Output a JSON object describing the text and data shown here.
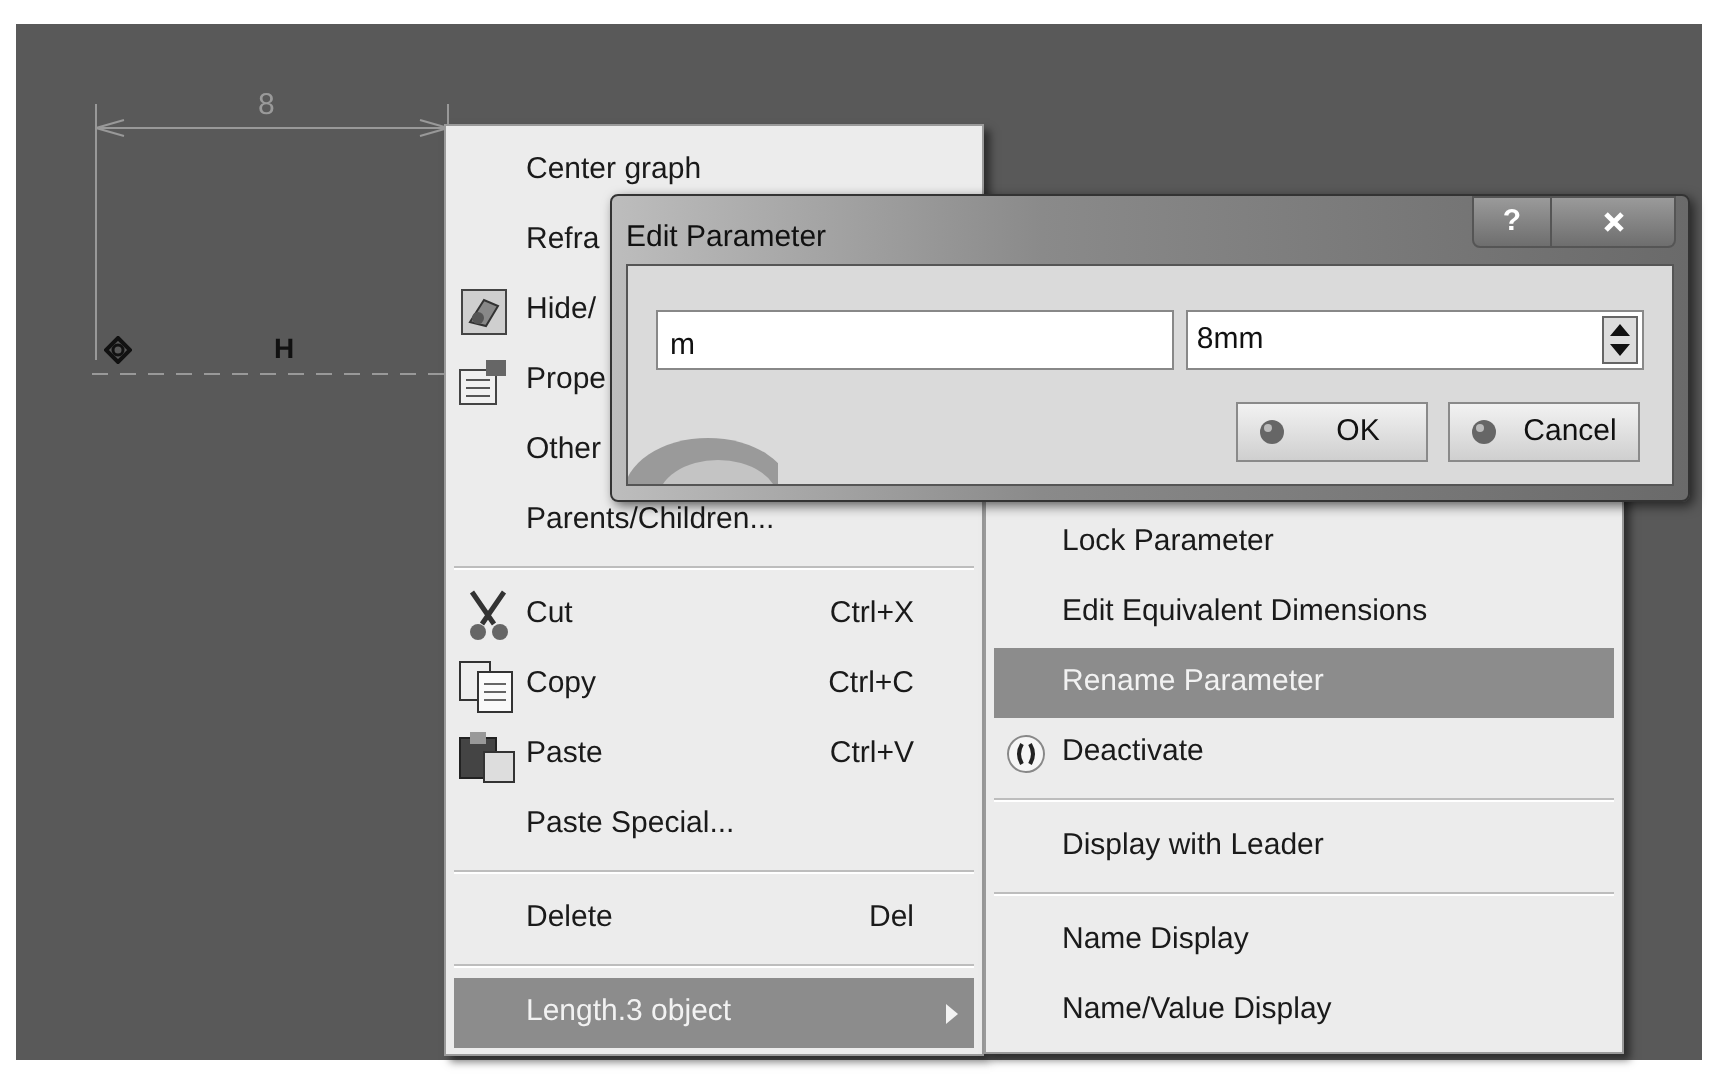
{
  "canvas": {
    "dimension_value": "8",
    "constraint_symbol": "H"
  },
  "context_menu": {
    "groups": [
      [
        {
          "label": "Center graph",
          "kind": "plain",
          "highlighted": false,
          "submenu": false
        },
        {
          "label": "Refra",
          "kind": "plain",
          "highlighted": false,
          "submenu": false
        },
        {
          "label": "Hide/",
          "kind": "hide-show",
          "highlighted": false,
          "submenu": false
        },
        {
          "label": "Prope",
          "kind": "properties",
          "highlighted": false,
          "submenu": false
        },
        {
          "label": "Other",
          "kind": "plain",
          "highlighted": false,
          "submenu": false
        },
        {
          "label": "Parents/Children...",
          "kind": "plain",
          "highlighted": false,
          "submenu": false
        }
      ],
      [
        {
          "label": "Cut",
          "kind": "cut",
          "shortcut": "Ctrl+X",
          "highlighted": false,
          "submenu": false
        },
        {
          "label": "Copy",
          "kind": "copy",
          "shortcut": "Ctrl+C",
          "highlighted": false,
          "submenu": false
        },
        {
          "label": "Paste",
          "kind": "paste",
          "shortcut": "Ctrl+V",
          "highlighted": false,
          "submenu": false
        },
        {
          "label": "Paste Special...",
          "kind": "plain",
          "highlighted": false,
          "submenu": false
        }
      ],
      [
        {
          "label": "Delete",
          "kind": "plain",
          "shortcut": "Del",
          "highlighted": false,
          "submenu": false
        }
      ],
      [
        {
          "label": "Length.3 object",
          "kind": "plain",
          "highlighted": true,
          "submenu": true
        }
      ]
    ]
  },
  "submenu": {
    "groups": [
      [
        {
          "label": "Lock Parameter",
          "kind": "plain",
          "highlighted": false
        },
        {
          "label": "Edit Equivalent Dimensions",
          "kind": "plain",
          "highlighted": false
        },
        {
          "label": "Rename Parameter",
          "kind": "plain",
          "highlighted": true
        },
        {
          "label": "Deactivate",
          "kind": "deactivate",
          "highlighted": false
        }
      ],
      [
        {
          "label": "Display with Leader",
          "kind": "plain",
          "highlighted": false
        }
      ],
      [
        {
          "label": "Name Display",
          "kind": "plain",
          "highlighted": false
        },
        {
          "label": "Name/Value Display",
          "kind": "plain",
          "highlighted": false
        }
      ]
    ]
  },
  "dialog": {
    "title": "Edit Parameter",
    "help_button": "?",
    "name_field": {
      "value": "m"
    },
    "value_field": {
      "value": "8mm"
    },
    "buttons": [
      "OK",
      "Cancel"
    ]
  }
}
